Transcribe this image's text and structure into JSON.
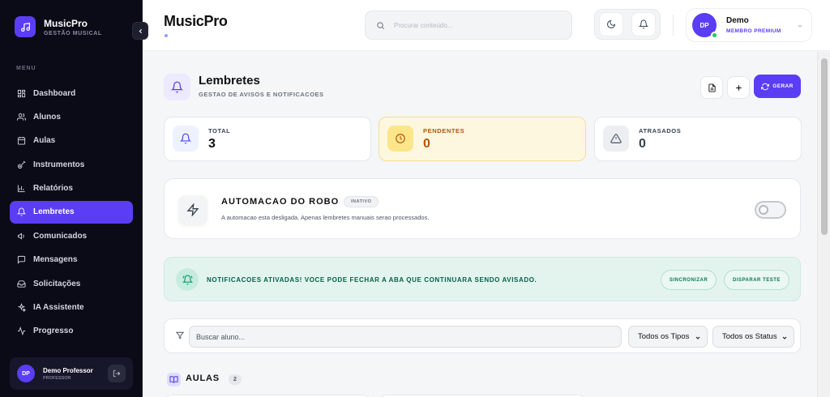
{
  "app": {
    "name": "MusicPro",
    "subtitle": "GESTÃO MUSICAL"
  },
  "sidebar": {
    "menu_label": "MENU",
    "items": [
      {
        "label": "Dashboard",
        "icon": "dashboard-icon",
        "active": false
      },
      {
        "label": "Alunos",
        "icon": "users-icon",
        "active": false
      },
      {
        "label": "Aulas",
        "icon": "calendar-icon",
        "active": false
      },
      {
        "label": "Instrumentos",
        "icon": "guitar-icon",
        "active": false
      },
      {
        "label": "Relatórios",
        "icon": "bar-chart-icon",
        "active": false
      },
      {
        "label": "Lembretes",
        "icon": "bell-icon",
        "active": true
      },
      {
        "label": "Comunicados",
        "icon": "megaphone-icon",
        "active": false
      },
      {
        "label": "Mensagens",
        "icon": "message-icon",
        "active": false
      },
      {
        "label": "Solicitações",
        "icon": "inbox-icon",
        "active": false
      },
      {
        "label": "IA Assistente",
        "icon": "sparkles-icon",
        "active": false
      },
      {
        "label": "Progresso",
        "icon": "activity-icon",
        "active": false
      }
    ],
    "user": {
      "initials": "DP",
      "name": "Demo Professor",
      "role": "PROFESSOR"
    }
  },
  "topbar": {
    "title": "MusicPro",
    "search_placeholder": "Procurar conteúdo...",
    "profile": {
      "initials": "DP",
      "name": "Demo",
      "role": "MEMBRO PREMIUM"
    }
  },
  "page": {
    "title": "Lembretes",
    "subtitle": "GESTAO DE AVISOS E NOTIFICACOES",
    "generate_label": "GERAR"
  },
  "stats": [
    {
      "label": "TOTAL",
      "value": "3"
    },
    {
      "label": "PENDENTES",
      "value": "0"
    },
    {
      "label": "ATRASADOS",
      "value": "0"
    }
  ],
  "automation": {
    "title": "AUTOMACAO DO ROBO",
    "badge": "INATIVO",
    "description": "A automacao esta desligada. Apenas lembretes manuais serao processados.",
    "enabled": false
  },
  "notice": {
    "text": "NOTIFICACOES ATIVADAS! VOCE PODE FECHAR A ABA QUE CONTINUARA SENDO AVISADO.",
    "sync_label": "SINCRONIZAR",
    "test_label": "DISPARAR TESTE"
  },
  "filters": {
    "search_placeholder": "Buscar aluno...",
    "type_select": "Todos os Tipos",
    "status_select": "Todos os Status"
  },
  "section": {
    "title": "AULAS",
    "count": "2"
  },
  "colors": {
    "accent": "#5b3df5",
    "sidebar_bg": "#0b0b17",
    "pending_bg": "#fef7e0",
    "notice_bg": "#e3f4ef"
  }
}
